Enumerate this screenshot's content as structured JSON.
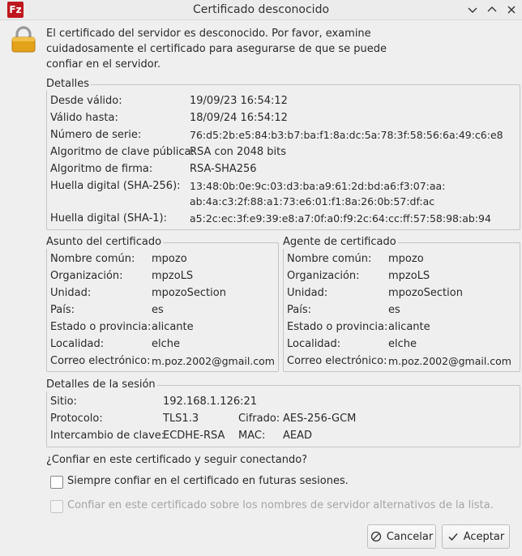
{
  "window": {
    "title": "Certificado desconocido",
    "app_icon_text": "Fz",
    "icons": {
      "app": "filezilla-icon",
      "minimize": "chevron-down-icon",
      "maximize": "chevron-up-icon",
      "close": "close-icon",
      "lock": "lock-icon"
    }
  },
  "intro": {
    "line1": "El certificado del servidor es desconocido. Por favor, examine",
    "line2": "cuidadosamente el certificado para asegurarse de que se puede",
    "line3": "confiar en el servidor."
  },
  "details": {
    "legend": "Detalles",
    "valid_from_label": "Desde válido:",
    "valid_from": "19/09/23 16:54:12",
    "valid_to_label": "Válido hasta:",
    "valid_to": "18/09/24 16:54:12",
    "serial_label": "Número de serie:",
    "serial": "76:d5:2b:e5:84:b3:b7:ba:f1:8a:dc:5a:78:3f:58:56:6a:49:c6:e8",
    "pubkey_label": "Algoritmo de clave pública:",
    "pubkey": "RSA con 2048 bits",
    "sigalg_label": "Algoritmo de firma:",
    "sigalg": "RSA-SHA256",
    "sha256_label": "Huella digital (SHA-256):",
    "sha256_line1": "13:48:0b:0e:9c:03:d3:ba:a9:61:2d:bd:a6:f3:07:aa:",
    "sha256_line2": "ab:4a:c3:2f:88:a1:73:e6:01:f1:8a:26:0b:57:df:ac",
    "sha1_label": "Huella digital (SHA-1):",
    "sha1": "a5:2c:ec:3f:e9:39:e8:a7:0f:a0:f9:2c:64:cc:ff:57:58:98:ab:94"
  },
  "subject": {
    "legend": "Asunto del certificado",
    "cn_label": "Nombre común:",
    "cn": "mpozo",
    "org_label": "Organización:",
    "org": "mpzoLS",
    "unit_label": "Unidad:",
    "unit": "mpozoSection",
    "country_label": "País:",
    "country": "es",
    "state_label": "Estado o provincia:",
    "state": "alicante",
    "locality_label": "Localidad:",
    "locality": "elche",
    "email_label": "Correo electrónico:",
    "email": "m.poz.2002@gmail.com"
  },
  "issuer": {
    "legend": "Agente de certificado",
    "cn_label": "Nombre común:",
    "cn": "mpozo",
    "org_label": "Organización:",
    "org": "mpzoLS",
    "unit_label": "Unidad:",
    "unit": "mpozoSection",
    "country_label": "País:",
    "country": "es",
    "state_label": "Estado o provincia:",
    "state": "alicante",
    "locality_label": "Localidad:",
    "locality": "elche",
    "email_label": "Correo electrónico:",
    "email": "m.poz.2002@gmail.com"
  },
  "session": {
    "legend": "Detalles de la sesión",
    "host_label": "Sitio:",
    "host": "192.168.1.126:21",
    "protocol_label": "Protocolo:",
    "protocol": "TLS1.3",
    "cipher_label": "Cifrado:",
    "cipher": "AES-256-GCM",
    "kex_label": "Intercambio de clave:",
    "kex": "ECDHE-RSA",
    "mac_label": "MAC:",
    "mac": "AEAD"
  },
  "question": "¿Confiar en este certificado y seguir conectando?",
  "options": {
    "always_trust": {
      "label": "Siempre confiar en el certificado en futuras sesiones.",
      "checked": false
    },
    "trust_altnames": {
      "label": "Confiar en este certificado sobre los nombres de servidor alternativos de la lista.",
      "checked": false,
      "enabled": false
    }
  },
  "buttons": {
    "cancel": "Cancelar",
    "accept": "Aceptar"
  }
}
